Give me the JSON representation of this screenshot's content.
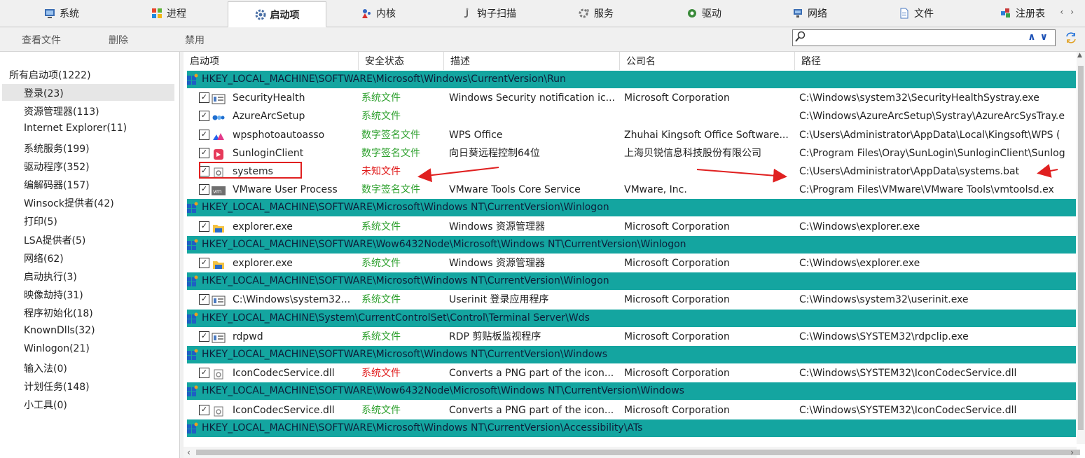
{
  "tabs": [
    {
      "label": "系统",
      "icon": "system-icon"
    },
    {
      "label": "进程",
      "icon": "windows-flag-icon"
    },
    {
      "label": "启动项",
      "icon": "gear-icon",
      "active": true
    },
    {
      "label": "内核",
      "icon": "kernel-icon"
    },
    {
      "label": "钩子扫描",
      "icon": "hook-icon"
    },
    {
      "label": "服务",
      "icon": "service-icon"
    },
    {
      "label": "驱动",
      "icon": "driver-icon"
    },
    {
      "label": "网络",
      "icon": "network-icon"
    },
    {
      "label": "文件",
      "icon": "file-icon"
    },
    {
      "label": "注册表",
      "icon": "registry-icon"
    }
  ],
  "toolbar": {
    "view_file": "查看文件",
    "delete": "删除",
    "disable": "禁用"
  },
  "search": {
    "placeholder": "",
    "value": ""
  },
  "sidebar": {
    "root": "所有启动项(1222)",
    "items": [
      "登录(23)",
      "资源管理器(113)",
      "Internet Explorer(11)",
      "系统服务(199)",
      "驱动程序(352)",
      "编解码器(157)",
      "Winsock提供者(42)",
      "打印(5)",
      "LSA提供者(5)",
      "网络(62)",
      "启动执行(3)",
      "映像劫持(31)",
      "程序初始化(18)",
      "KnownDlls(32)",
      "Winlogon(21)",
      "输入法(0)",
      "计划任务(148)",
      "小工具(0)"
    ],
    "selected": 0
  },
  "columns": [
    "启动项",
    "安全状态",
    "描述",
    "公司名",
    "路径"
  ],
  "groups": [
    {
      "key": "HKEY_LOCAL_MACHINE\\SOFTWARE\\Microsoft\\Windows\\CurrentVersion\\Run",
      "rows": [
        {
          "name": "SecurityHealth",
          "status": "系统文件",
          "desc": "Windows Security notification ic...",
          "company": "Microsoft Corporation",
          "path": "C:\\Windows\\system32\\SecurityHealthSystray.exe",
          "icon": "window-app-icon",
          "status_color": "green"
        },
        {
          "name": "AzureArcSetup",
          "status": "系统文件",
          "desc": "",
          "company": "",
          "path": "C:\\Windows\\AzureArcSetup\\Systray\\AzureArcSysTray.e",
          "icon": "azure-arc-icon",
          "status_color": "green"
        },
        {
          "name": "wpsphotoautoasso",
          "status": "数字签名文件",
          "desc": "WPS Office",
          "company": "Zhuhai Kingsoft Office Software...",
          "path": "C:\\Users\\Administrator\\AppData\\Local\\Kingsoft\\WPS (",
          "icon": "wps-photo-icon",
          "status_color": "green"
        },
        {
          "name": "SunloginClient",
          "status": "数字签名文件",
          "desc": "向日葵远程控制64位",
          "company": "上海贝锐信息科技股份有限公司",
          "path": "C:\\Program Files\\Oray\\SunLogin\\SunloginClient\\Sunlog",
          "icon": "sunlogin-icon",
          "status_color": "green"
        },
        {
          "name": "systems",
          "status": "未知文件",
          "desc": "",
          "company": "",
          "path": "C:\\Users\\Administrator\\AppData\\systems.bat",
          "icon": "batch-file-icon",
          "status_color": "red"
        },
        {
          "name": "VMware User Process",
          "status": "数字签名文件",
          "desc": "VMware Tools Core Service",
          "company": "VMware, Inc.",
          "path": "C:\\Program Files\\VMware\\VMware Tools\\vmtoolsd.ex",
          "icon": "vmware-icon",
          "status_color": "green"
        }
      ]
    },
    {
      "key": "HKEY_LOCAL_MACHINE\\SOFTWARE\\Microsoft\\Windows NT\\CurrentVersion\\Winlogon",
      "rows": [
        {
          "name": "explorer.exe",
          "status": "系统文件",
          "desc": "Windows 资源管理器",
          "company": "Microsoft Corporation",
          "path": "C:\\Windows\\explorer.exe",
          "icon": "folder-icon",
          "status_color": "green"
        }
      ]
    },
    {
      "key": "HKEY_LOCAL_MACHINE\\SOFTWARE\\Wow6432Node\\Microsoft\\Windows NT\\CurrentVersion\\Winlogon",
      "rows": [
        {
          "name": "explorer.exe",
          "status": "系统文件",
          "desc": "Windows 资源管理器",
          "company": "Microsoft Corporation",
          "path": "C:\\Windows\\explorer.exe",
          "icon": "folder-icon",
          "status_color": "green"
        }
      ]
    },
    {
      "key": "HKEY_LOCAL_MACHINE\\SOFTWARE\\Microsoft\\Windows NT\\CurrentVersion\\Winlogon",
      "rows": [
        {
          "name": "C:\\Windows\\system32...",
          "status": "系统文件",
          "desc": "Userinit 登录应用程序",
          "company": "Microsoft Corporation",
          "path": "C:\\Windows\\system32\\userinit.exe",
          "icon": "window-app-icon",
          "status_color": "green"
        }
      ]
    },
    {
      "key": "HKEY_LOCAL_MACHINE\\System\\CurrentControlSet\\Control\\Terminal Server\\Wds",
      "rows": [
        {
          "name": "rdpwd",
          "status": "系统文件",
          "desc": "RDP 剪贴板监视程序",
          "company": "Microsoft Corporation",
          "path": "C:\\Windows\\SYSTEM32\\rdpclip.exe",
          "icon": "window-app-icon",
          "status_color": "green"
        }
      ]
    },
    {
      "key": "HKEY_LOCAL_MACHINE\\SOFTWARE\\Microsoft\\Windows NT\\CurrentVersion\\Windows",
      "rows": [
        {
          "name": "IconCodecService.dll",
          "status": "系统文件",
          "desc": "Converts a PNG part of the icon...",
          "company": "Microsoft Corporation",
          "path": "C:\\Windows\\SYSTEM32\\IconCodecService.dll",
          "icon": "dll-file-icon",
          "status_color": "red"
        }
      ]
    },
    {
      "key": "HKEY_LOCAL_MACHINE\\SOFTWARE\\Wow6432Node\\Microsoft\\Windows NT\\CurrentVersion\\Windows",
      "rows": [
        {
          "name": "IconCodecService.dll",
          "status": "系统文件",
          "desc": "Converts a PNG part of the icon...",
          "company": "Microsoft Corporation",
          "path": "C:\\Windows\\SYSTEM32\\IconCodecService.dll",
          "icon": "dll-file-icon",
          "status_color": "green"
        }
      ]
    },
    {
      "key": "HKEY_LOCAL_MACHINE\\SOFTWARE\\Microsoft\\Windows NT\\CurrentVersion\\Accessibility\\ATs",
      "rows": []
    }
  ],
  "colors": {
    "group_bg": "#14a5a0",
    "ok": "#2da02d",
    "unknown": "#e01818",
    "highlight": "#e02020"
  }
}
